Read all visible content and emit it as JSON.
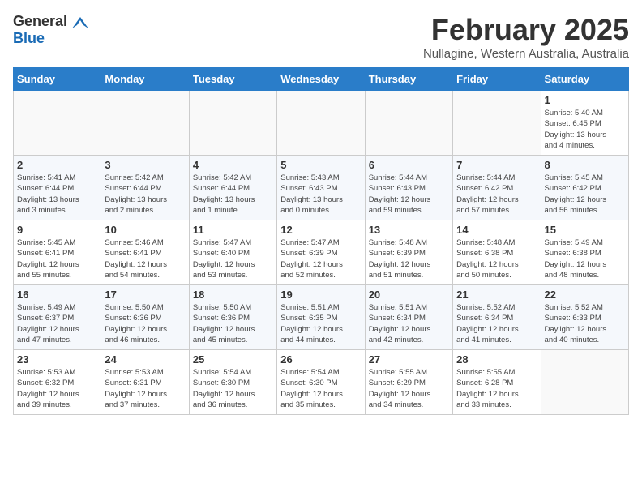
{
  "header": {
    "logo_general": "General",
    "logo_blue": "Blue",
    "month_title": "February 2025",
    "location": "Nullagine, Western Australia, Australia"
  },
  "days_of_week": [
    "Sunday",
    "Monday",
    "Tuesday",
    "Wednesday",
    "Thursday",
    "Friday",
    "Saturday"
  ],
  "weeks": [
    [
      {
        "day": "",
        "info": ""
      },
      {
        "day": "",
        "info": ""
      },
      {
        "day": "",
        "info": ""
      },
      {
        "day": "",
        "info": ""
      },
      {
        "day": "",
        "info": ""
      },
      {
        "day": "",
        "info": ""
      },
      {
        "day": "1",
        "info": "Sunrise: 5:40 AM\nSunset: 6:45 PM\nDaylight: 13 hours\nand 4 minutes."
      }
    ],
    [
      {
        "day": "2",
        "info": "Sunrise: 5:41 AM\nSunset: 6:44 PM\nDaylight: 13 hours\nand 3 minutes."
      },
      {
        "day": "3",
        "info": "Sunrise: 5:42 AM\nSunset: 6:44 PM\nDaylight: 13 hours\nand 2 minutes."
      },
      {
        "day": "4",
        "info": "Sunrise: 5:42 AM\nSunset: 6:44 PM\nDaylight: 13 hours\nand 1 minute."
      },
      {
        "day": "5",
        "info": "Sunrise: 5:43 AM\nSunset: 6:43 PM\nDaylight: 13 hours\nand 0 minutes."
      },
      {
        "day": "6",
        "info": "Sunrise: 5:44 AM\nSunset: 6:43 PM\nDaylight: 12 hours\nand 59 minutes."
      },
      {
        "day": "7",
        "info": "Sunrise: 5:44 AM\nSunset: 6:42 PM\nDaylight: 12 hours\nand 57 minutes."
      },
      {
        "day": "8",
        "info": "Sunrise: 5:45 AM\nSunset: 6:42 PM\nDaylight: 12 hours\nand 56 minutes."
      }
    ],
    [
      {
        "day": "9",
        "info": "Sunrise: 5:45 AM\nSunset: 6:41 PM\nDaylight: 12 hours\nand 55 minutes."
      },
      {
        "day": "10",
        "info": "Sunrise: 5:46 AM\nSunset: 6:41 PM\nDaylight: 12 hours\nand 54 minutes."
      },
      {
        "day": "11",
        "info": "Sunrise: 5:47 AM\nSunset: 6:40 PM\nDaylight: 12 hours\nand 53 minutes."
      },
      {
        "day": "12",
        "info": "Sunrise: 5:47 AM\nSunset: 6:39 PM\nDaylight: 12 hours\nand 52 minutes."
      },
      {
        "day": "13",
        "info": "Sunrise: 5:48 AM\nSunset: 6:39 PM\nDaylight: 12 hours\nand 51 minutes."
      },
      {
        "day": "14",
        "info": "Sunrise: 5:48 AM\nSunset: 6:38 PM\nDaylight: 12 hours\nand 50 minutes."
      },
      {
        "day": "15",
        "info": "Sunrise: 5:49 AM\nSunset: 6:38 PM\nDaylight: 12 hours\nand 48 minutes."
      }
    ],
    [
      {
        "day": "16",
        "info": "Sunrise: 5:49 AM\nSunset: 6:37 PM\nDaylight: 12 hours\nand 47 minutes."
      },
      {
        "day": "17",
        "info": "Sunrise: 5:50 AM\nSunset: 6:36 PM\nDaylight: 12 hours\nand 46 minutes."
      },
      {
        "day": "18",
        "info": "Sunrise: 5:50 AM\nSunset: 6:36 PM\nDaylight: 12 hours\nand 45 minutes."
      },
      {
        "day": "19",
        "info": "Sunrise: 5:51 AM\nSunset: 6:35 PM\nDaylight: 12 hours\nand 44 minutes."
      },
      {
        "day": "20",
        "info": "Sunrise: 5:51 AM\nSunset: 6:34 PM\nDaylight: 12 hours\nand 42 minutes."
      },
      {
        "day": "21",
        "info": "Sunrise: 5:52 AM\nSunset: 6:34 PM\nDaylight: 12 hours\nand 41 minutes."
      },
      {
        "day": "22",
        "info": "Sunrise: 5:52 AM\nSunset: 6:33 PM\nDaylight: 12 hours\nand 40 minutes."
      }
    ],
    [
      {
        "day": "23",
        "info": "Sunrise: 5:53 AM\nSunset: 6:32 PM\nDaylight: 12 hours\nand 39 minutes."
      },
      {
        "day": "24",
        "info": "Sunrise: 5:53 AM\nSunset: 6:31 PM\nDaylight: 12 hours\nand 37 minutes."
      },
      {
        "day": "25",
        "info": "Sunrise: 5:54 AM\nSunset: 6:30 PM\nDaylight: 12 hours\nand 36 minutes."
      },
      {
        "day": "26",
        "info": "Sunrise: 5:54 AM\nSunset: 6:30 PM\nDaylight: 12 hours\nand 35 minutes."
      },
      {
        "day": "27",
        "info": "Sunrise: 5:55 AM\nSunset: 6:29 PM\nDaylight: 12 hours\nand 34 minutes."
      },
      {
        "day": "28",
        "info": "Sunrise: 5:55 AM\nSunset: 6:28 PM\nDaylight: 12 hours\nand 33 minutes."
      },
      {
        "day": "",
        "info": ""
      }
    ]
  ]
}
